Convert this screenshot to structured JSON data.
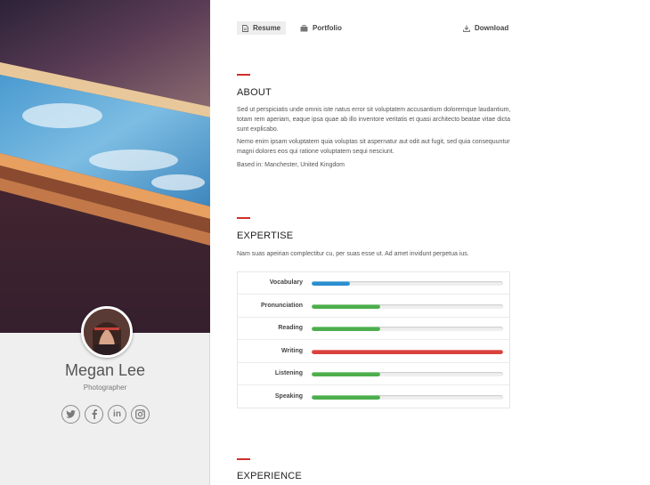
{
  "profile": {
    "name": "Megan Lee",
    "role": "Photographer",
    "socials": [
      {
        "icon": "twitter-icon"
      },
      {
        "icon": "facebook-icon"
      },
      {
        "icon": "linkedin-icon",
        "glyph": "in"
      },
      {
        "icon": "instagram-icon"
      }
    ]
  },
  "nav": {
    "resume": "Resume",
    "portfolio": "Portfolio",
    "download": "Download"
  },
  "about": {
    "title": "ABOUT",
    "p1": "Sed ut perspiciatis unde omnis iste natus error sit voluptatem accusantium doloremque laudantium, totam rem aperiam, eaque ipsa quae ab illo inventore veritatis et quasi architecto beatae vitae dicta sunt explicabo.",
    "p2": "Nemo enim ipsam voluptatem quia voluptas sit aspernatur aut odit aut fugit, sed quia consequuntur magni dolores eos qui ratione voluptatem sequi nesciunt.",
    "based": "Based in: Manchester, United Kingdom"
  },
  "expertise": {
    "title": "EXPERTISE",
    "intro": "Nam suas apeirian complectitur cu, per suas esse ut. Ad amet invidunt perpetua ius.",
    "skills": [
      {
        "label": "Vocabulary",
        "level": 0.2,
        "color": "#2a8fd0"
      },
      {
        "label": "Pronunciation",
        "level": 0.36,
        "color": "#4cae4c"
      },
      {
        "label": "Reading",
        "level": 0.36,
        "color": "#4cae4c"
      },
      {
        "label": "Writing",
        "level": 1.0,
        "color": "#d9413b"
      },
      {
        "label": "Listening",
        "level": 0.36,
        "color": "#4cae4c"
      },
      {
        "label": "Speaking",
        "level": 0.36,
        "color": "#4cae4c"
      }
    ]
  },
  "experience": {
    "title": "EXPERIENCE"
  },
  "theme": {
    "accent": "#d0302a"
  }
}
